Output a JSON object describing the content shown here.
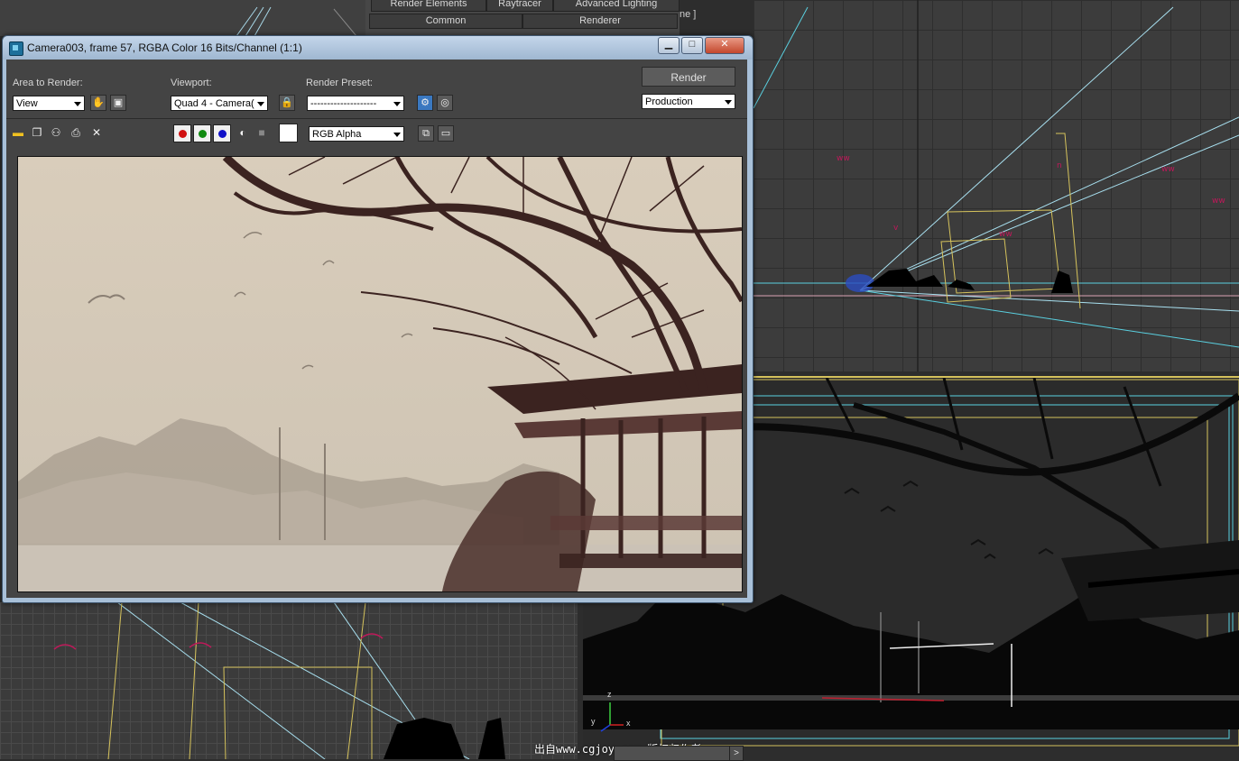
{
  "render_setup": {
    "tabs_row1": [
      "Render Elements",
      "Raytracer",
      "Advanced Lighting"
    ],
    "tabs_row2": [
      "Common",
      "Renderer"
    ],
    "right_label": "ne ]"
  },
  "frame_window": {
    "title": "Camera003, frame 57, RGBA Color 16 Bits/Channel (1:1)",
    "controls": {
      "minimize": "▁",
      "maximize": "□",
      "close": "✕"
    },
    "area_to_render": {
      "label": "Area to Render:",
      "value": "View"
    },
    "viewport": {
      "label": "Viewport:",
      "value": "Quad 4 - Camera("
    },
    "render_preset": {
      "label": "Render Preset:",
      "value": "--------------------"
    },
    "render_button": "Render",
    "production": {
      "value": "Production"
    },
    "channel_display": {
      "value": "RGB Alpha"
    },
    "colors": {
      "red": "#d01010",
      "green": "#108a10",
      "blue": "#1010c8",
      "swatch": "#ffffff"
    }
  },
  "viewport_labels": {
    "axis_z": "z",
    "axis_x": "x",
    "axis_y": "y"
  },
  "watermark": "出自www.cgjoy.com 版权归作者",
  "timeline": {
    "arrow": ">"
  }
}
